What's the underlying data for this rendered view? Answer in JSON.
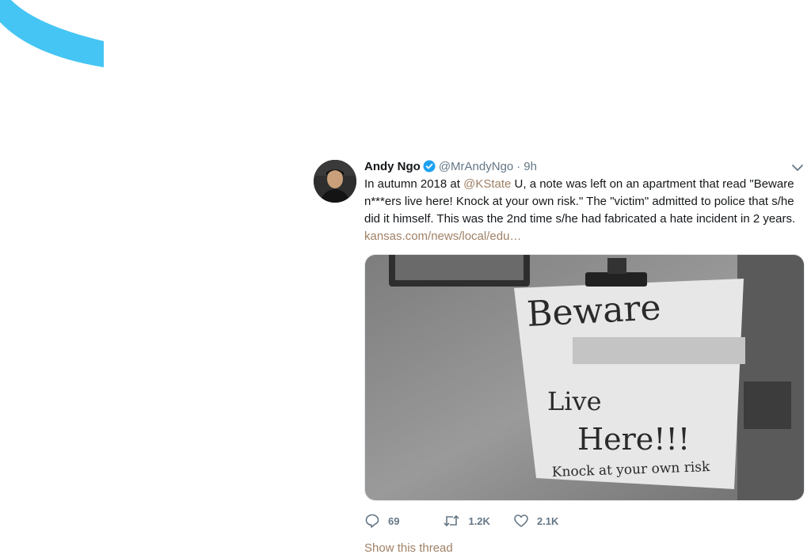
{
  "tweet": {
    "author": {
      "name": "Andy Ngo",
      "handle": "@MrAndyNgo",
      "time": "9h",
      "separator": "·"
    },
    "text": {
      "part1": "In autumn 2018 at ",
      "mention": "@KState",
      "part2": " U, a note was left on an apartment that read \"Beware n***ers live here! Knock at your own risk.\" The \"victim\" admitted to police that s/he did it himself. This was the 2nd time s/he had fabricated a hate incident in 2 years. ",
      "link": "kansas.com/news/local/edu…"
    },
    "photo_note": {
      "line1": "Beware",
      "line3": "Live",
      "line4": "Here!!!",
      "line5": "Knock at your own risk"
    },
    "stats": {
      "replies": "69",
      "retweets": "1.2K",
      "likes": "2.1K"
    },
    "show_thread": "Show this thread"
  },
  "colors": {
    "accent_link": "#a08166",
    "meta_gray": "#657786",
    "verified_blue": "#1da1f2",
    "decor_arc": "#45c5f3"
  },
  "icons": [
    "verified-badge-icon",
    "chevron-down-icon",
    "reply-icon",
    "retweet-icon",
    "like-icon"
  ]
}
